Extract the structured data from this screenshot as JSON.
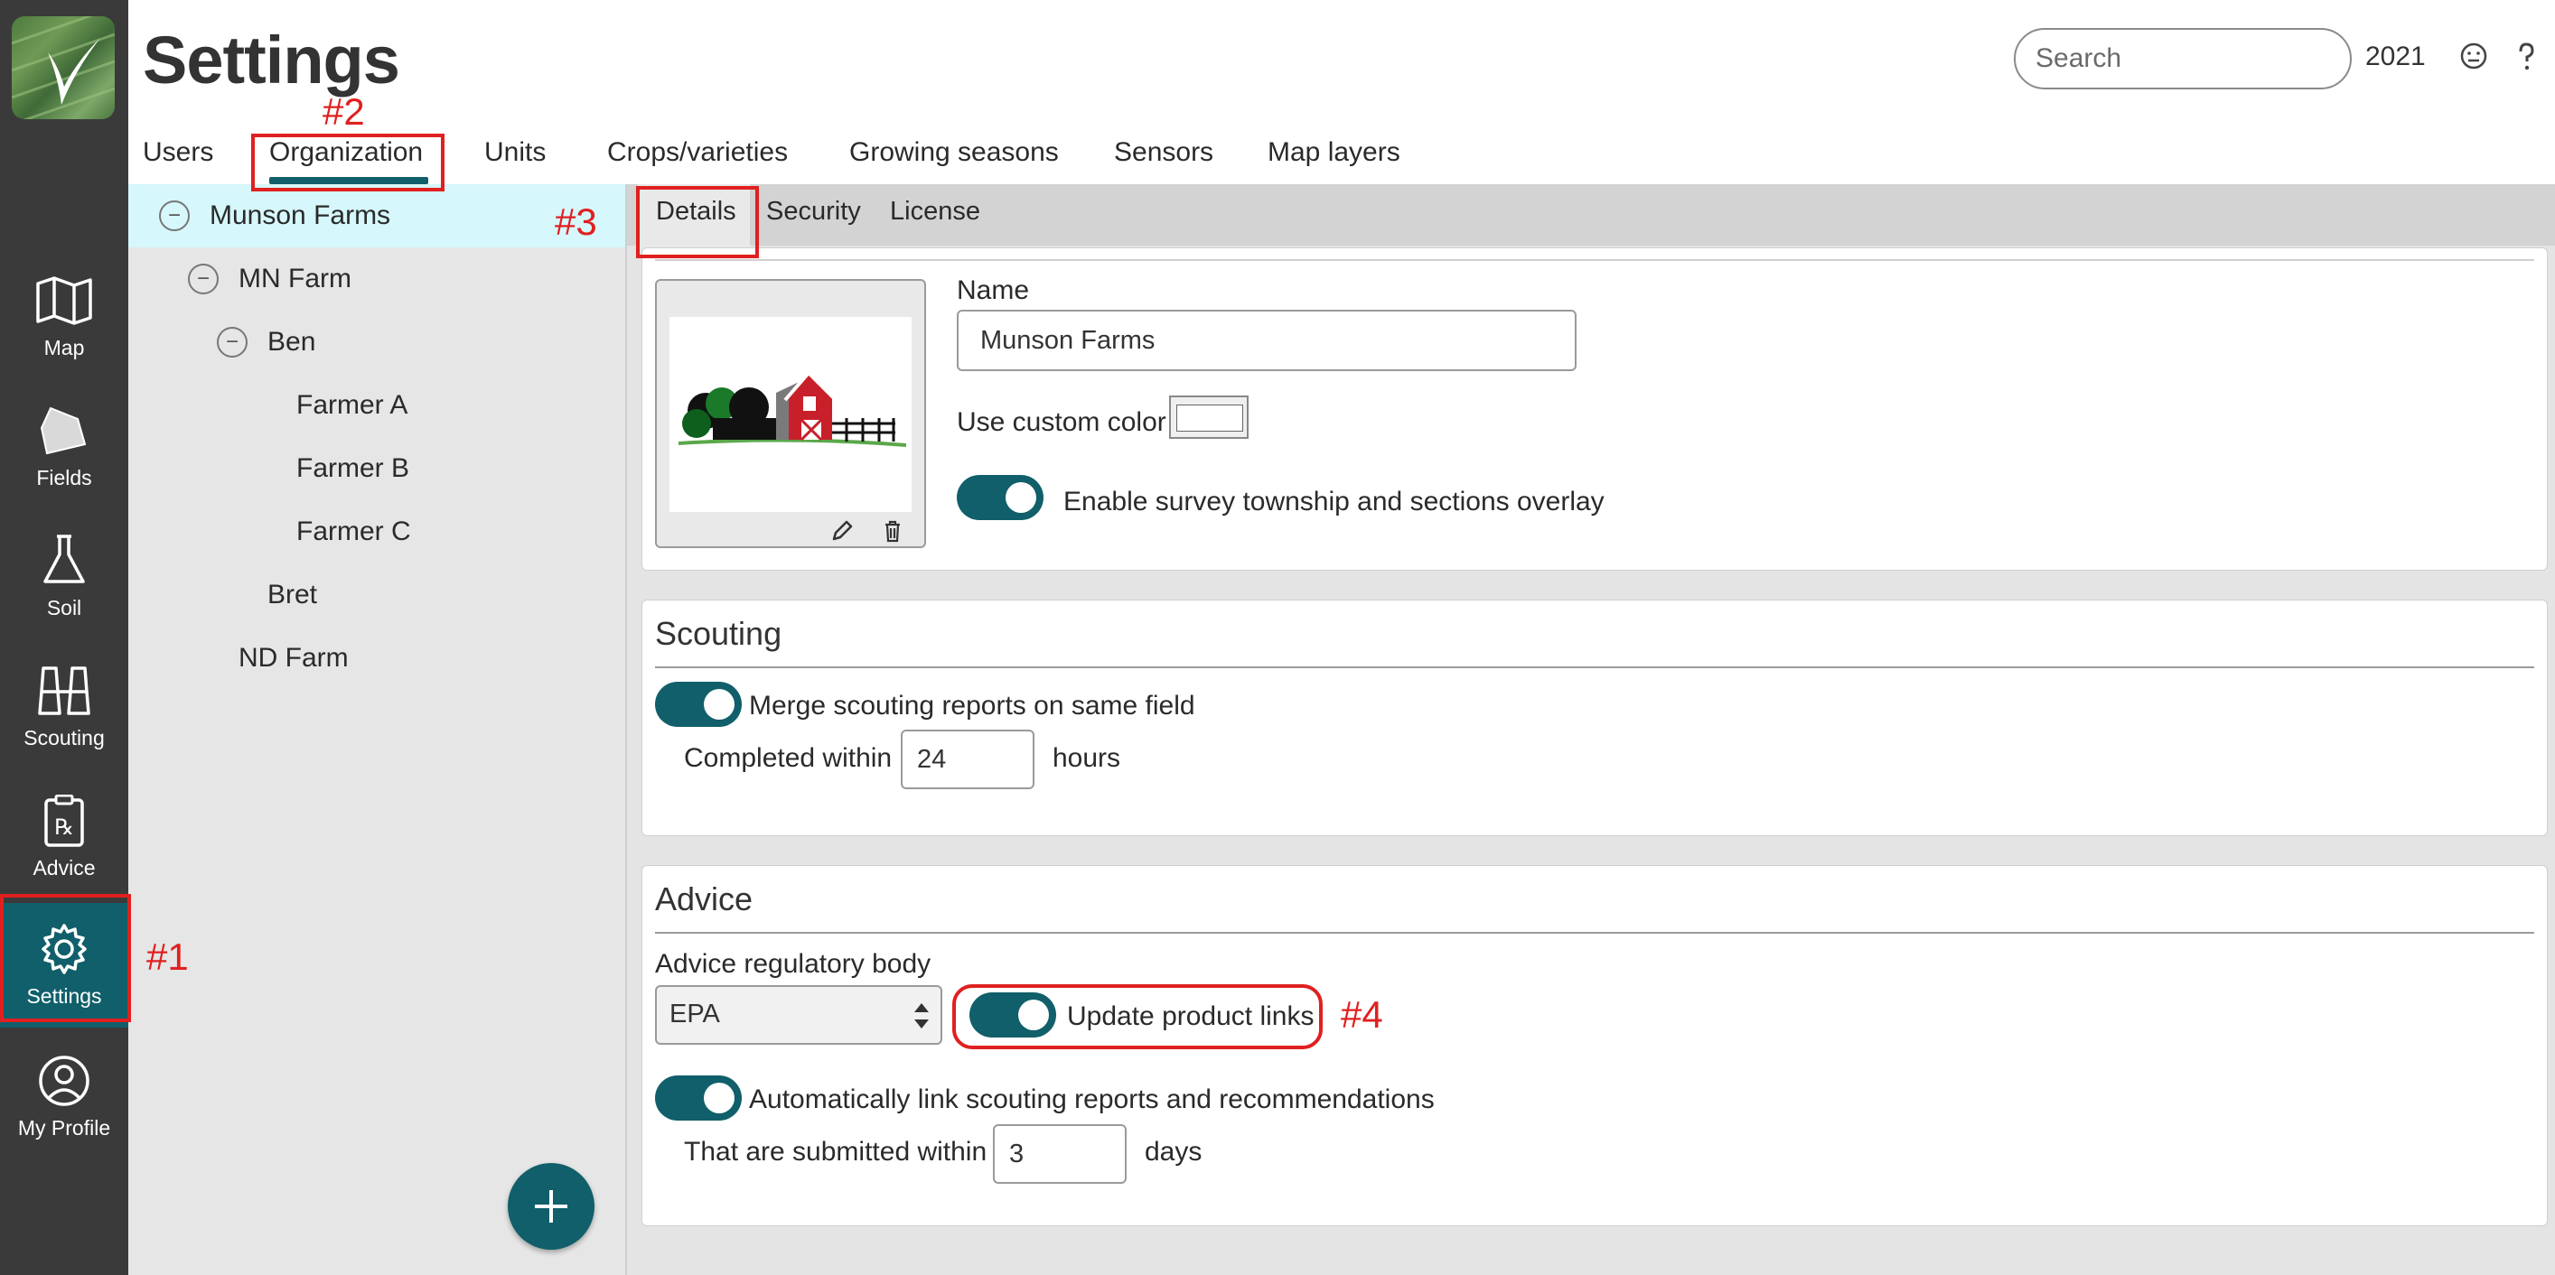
{
  "app": {
    "title": "Settings",
    "search_placeholder": "Search",
    "year": "2021"
  },
  "rail": {
    "items": [
      {
        "label": "Map",
        "icon": "map-icon"
      },
      {
        "label": "Fields",
        "icon": "field-icon"
      },
      {
        "label": "Soil",
        "icon": "flask-icon"
      },
      {
        "label": "Scouting",
        "icon": "binoculars-icon"
      },
      {
        "label": "Advice",
        "icon": "prescription-icon"
      },
      {
        "label": "Settings",
        "icon": "gear-icon",
        "active": true
      },
      {
        "label": "My Profile",
        "icon": "profile-icon"
      }
    ]
  },
  "tabs": [
    {
      "label": "Users"
    },
    {
      "label": "Organization",
      "active": true
    },
    {
      "label": "Units"
    },
    {
      "label": "Crops/varieties"
    },
    {
      "label": "Growing seasons"
    },
    {
      "label": "Sensors"
    },
    {
      "label": "Map layers"
    }
  ],
  "tree": [
    {
      "label": "Munson Farms",
      "expanded": true,
      "selected": true
    },
    {
      "label": "MN Farm",
      "expanded": true
    },
    {
      "label": "Ben",
      "expanded": true
    },
    {
      "label": "Farmer A"
    },
    {
      "label": "Farmer B"
    },
    {
      "label": "Farmer C"
    },
    {
      "label": "Bret"
    },
    {
      "label": "ND Farm"
    }
  ],
  "subtabs": [
    {
      "label": "Details",
      "active": true
    },
    {
      "label": "Security"
    },
    {
      "label": "License"
    }
  ],
  "details": {
    "name_label": "Name",
    "name_value": "Munson Farms",
    "custom_color_label": "Use custom color",
    "survey_overlay_label": "Enable survey township and sections overlay",
    "survey_overlay_on": true
  },
  "scouting": {
    "title": "Scouting",
    "merge_label": "Merge scouting reports on same field",
    "merge_on": true,
    "completed_within_label": "Completed within",
    "completed_within_value": "24",
    "hours_label": "hours"
  },
  "advice": {
    "title": "Advice",
    "regulatory_label": "Advice regulatory body",
    "regulatory_value": "EPA",
    "update_links_label": "Update product links",
    "update_links_on": true,
    "autolink_label": "Automatically link scouting reports and recommendations",
    "autolink_on": true,
    "submitted_within_label": "That are submitted within",
    "submitted_within_value": "3",
    "days_label": "days"
  },
  "annotations": [
    "#1",
    "#2",
    "#3",
    "#4"
  ],
  "colors": {
    "accent": "#105f6a",
    "rail_bg": "#3a3a3a",
    "annotation": "#e02020",
    "tree_selected": "#d6f7fb"
  }
}
